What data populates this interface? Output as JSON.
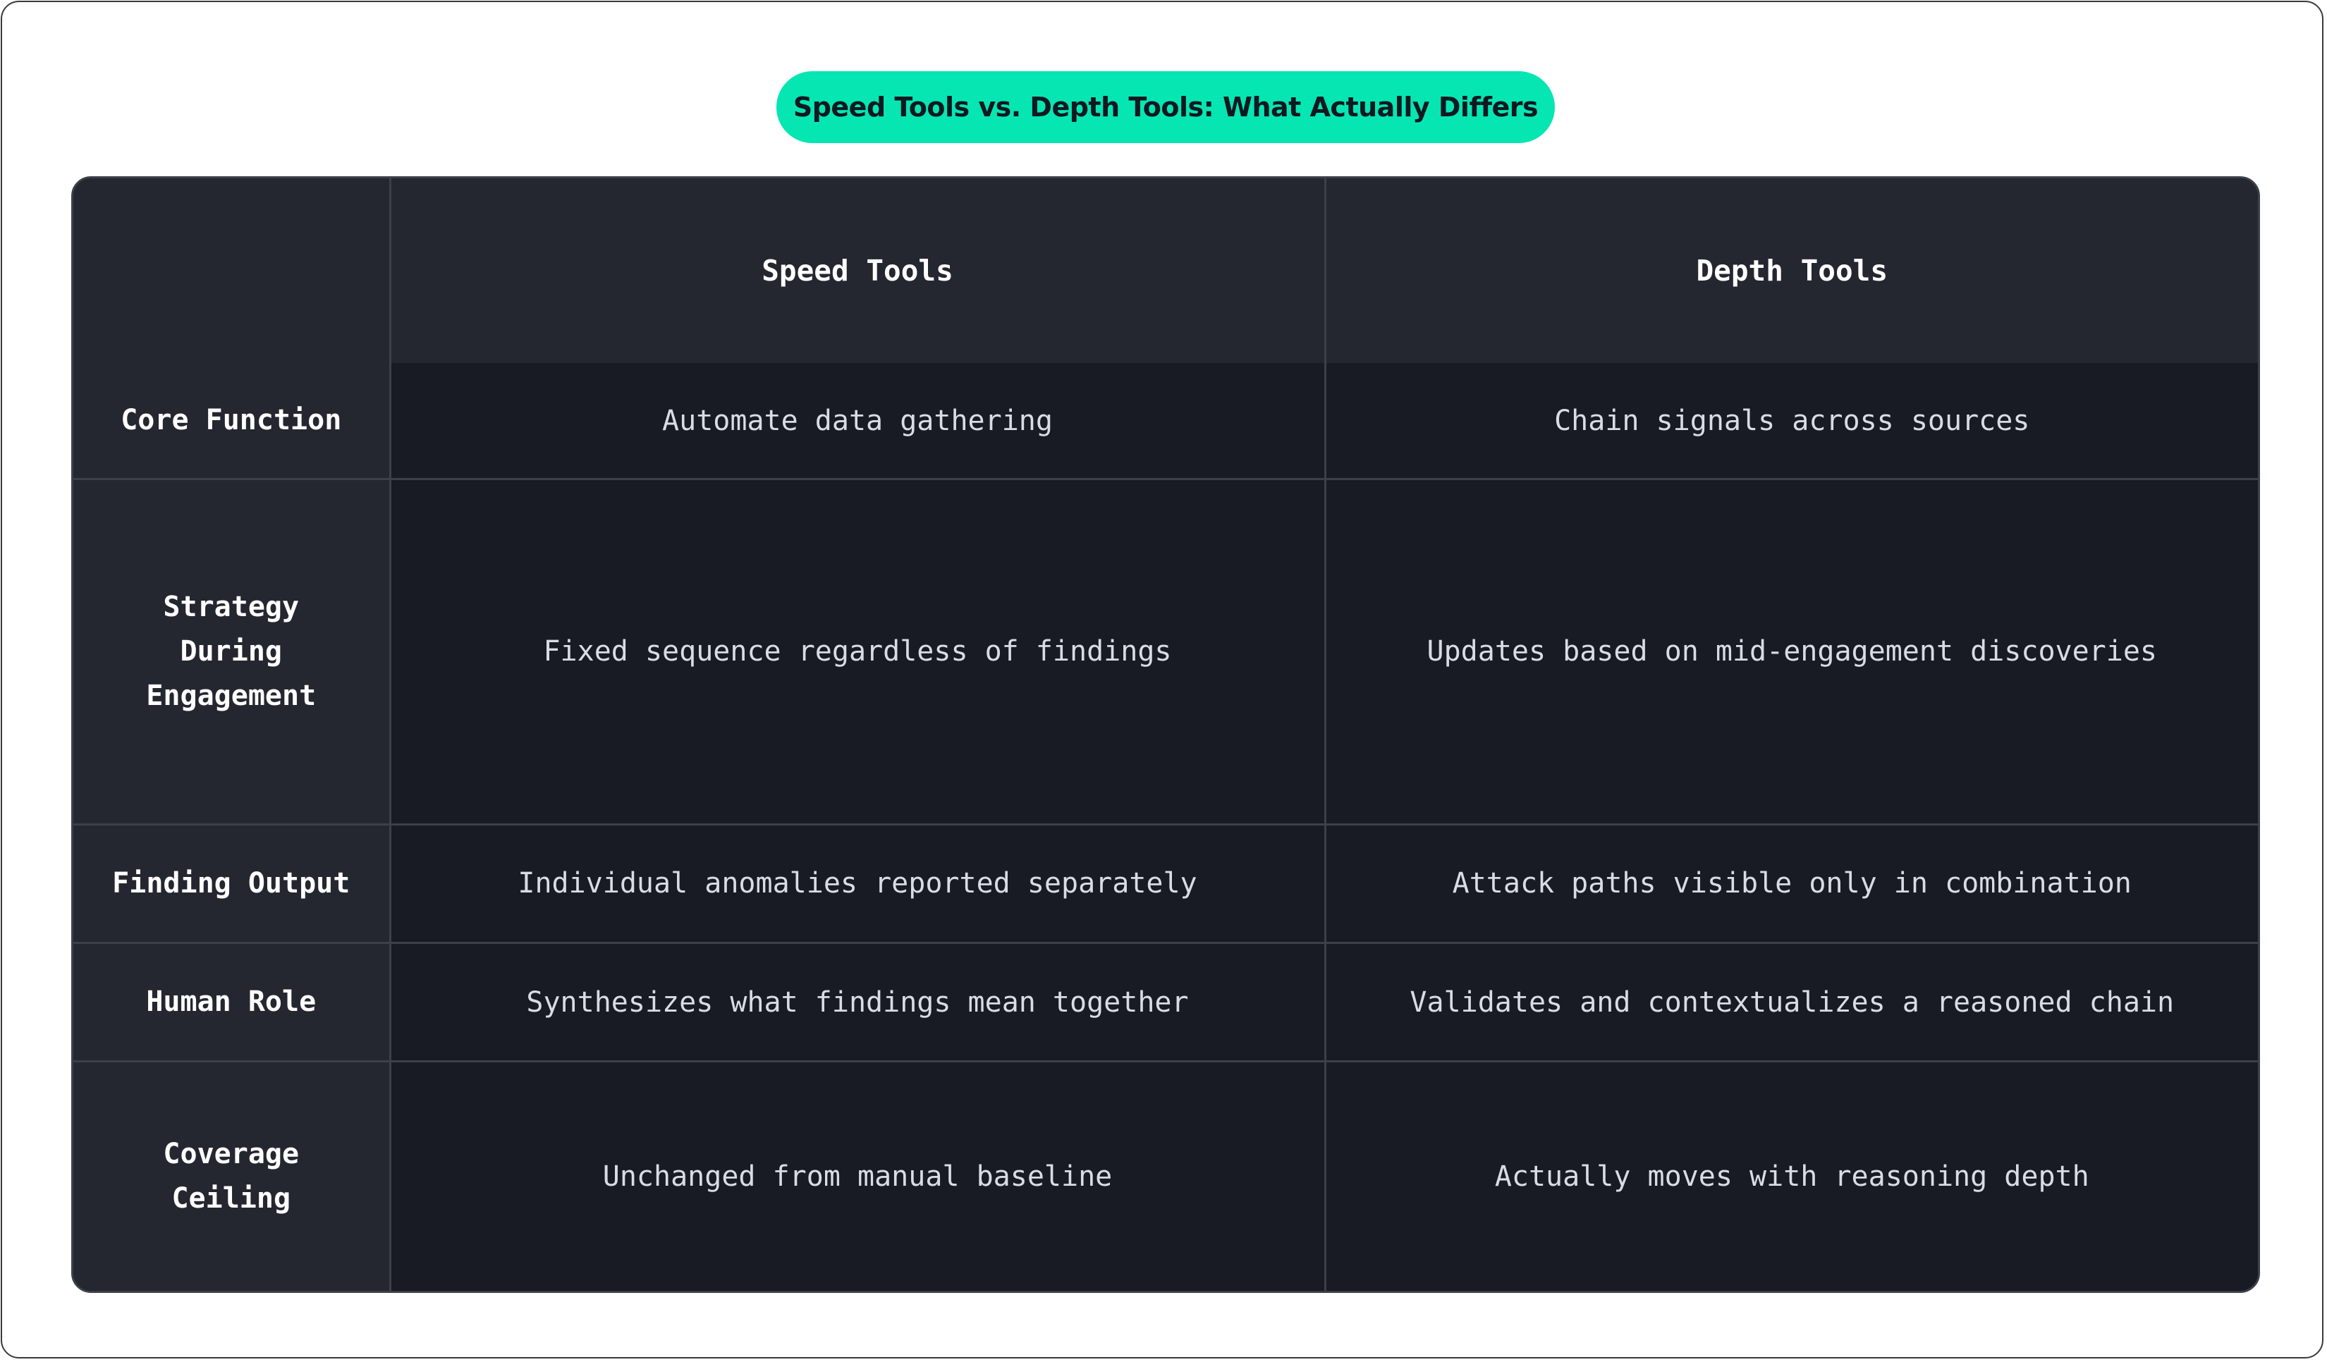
{
  "title": "Speed Tools vs. Depth Tools: What Actually Differs",
  "table": {
    "corner": "",
    "columns": [
      "Speed Tools",
      "Depth Tools"
    ],
    "rows": [
      {
        "label": "Core Function",
        "cells": [
          "Automate data gathering",
          "Chain signals across sources"
        ]
      },
      {
        "label": "Strategy During Engagement",
        "cells": [
          "Fixed sequence regardless of findings",
          "Updates based on mid-engagement discoveries"
        ]
      },
      {
        "label": "Finding Output",
        "cells": [
          "Individual anomalies reported separately",
          "Attack paths visible only in combination"
        ]
      },
      {
        "label": "Human Role",
        "cells": [
          "Synthesizes what findings mean together",
          "Validates and contextualizes a reasoned chain"
        ]
      },
      {
        "label": "Coverage Ceiling",
        "cells": [
          "Unchanged from manual baseline",
          "Actually moves with reasoning depth"
        ]
      }
    ]
  },
  "colors": {
    "title_pill": "#06e6b3",
    "header_bg": "#242730",
    "cell_bg": "#181b23",
    "grid_line": "#3c404a"
  }
}
